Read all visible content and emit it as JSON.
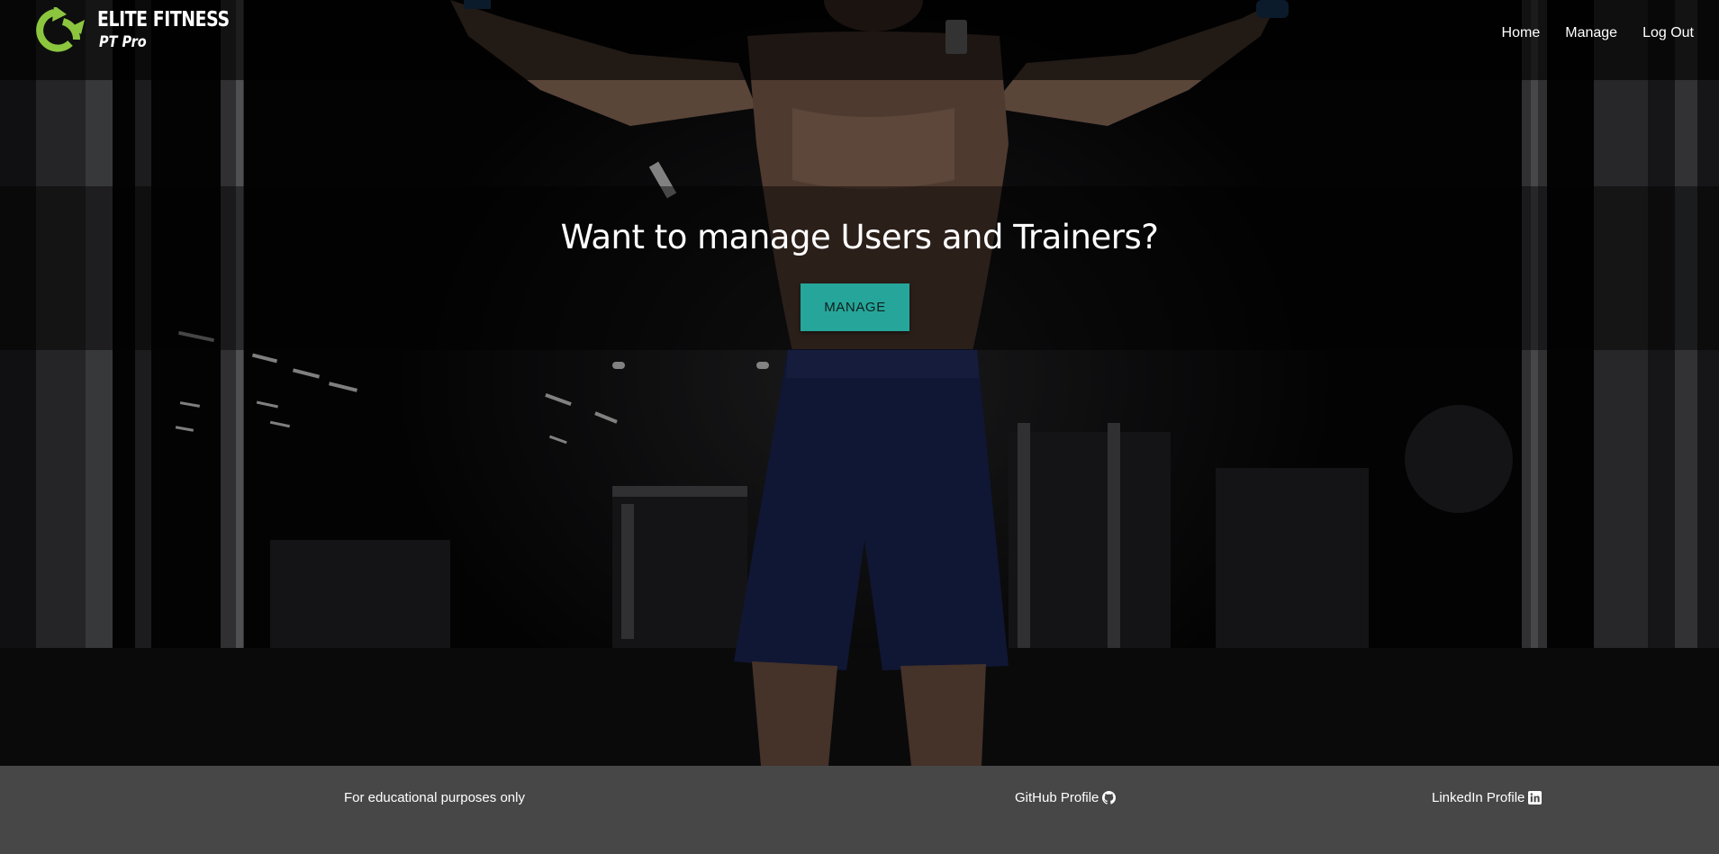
{
  "brand": {
    "name": "ELITE FITNESS",
    "subtitle": "PT Pro",
    "logo_icon": "recycle-arrows-logo-icon",
    "accent_color": "#8cc63f"
  },
  "nav": {
    "links": [
      {
        "label": "Home"
      },
      {
        "label": "Manage"
      },
      {
        "label": "Log Out"
      }
    ]
  },
  "hero": {
    "title": "Want to manage Users and Trainers?",
    "button_label": "MANAGE",
    "button_color": "#26a69a"
  },
  "footer": {
    "note": "For educational purposes only",
    "github_label": "GitHub Profile",
    "github_icon": "github-icon",
    "linkedin_label": "LinkedIn Profile",
    "linkedin_icon": "linkedin-icon",
    "background_color": "#474747"
  }
}
